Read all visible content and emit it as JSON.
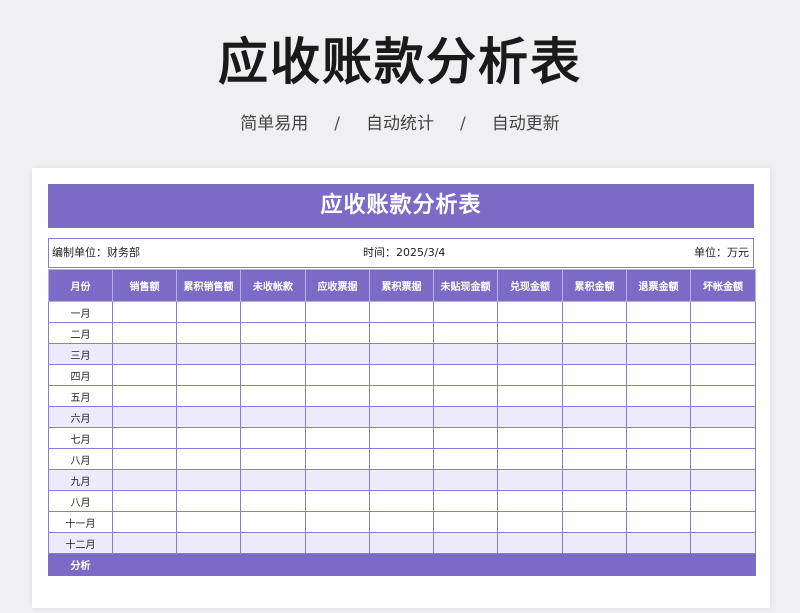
{
  "header": {
    "title": "应收账款分析表",
    "tags": [
      "简单易用",
      "自动统计",
      "自动更新"
    ],
    "separator": "/"
  },
  "sheet": {
    "banner": "应收账款分析表",
    "info": {
      "unit_label": "编制单位：财务部",
      "time_label": "时间：2025/3/4",
      "currency_label": "单位：万元"
    },
    "columns": [
      "月份",
      "销售额",
      "累积销售额",
      "未收帐款",
      "应收票据",
      "累积票据",
      "未贴现金额",
      "兑现金额",
      "累积金额",
      "退票金额",
      "坏帐金额"
    ],
    "months": [
      "一月",
      "二月",
      "三月",
      "四月",
      "五月",
      "六月",
      "七月",
      "八月",
      "九月",
      "八月",
      "十一月",
      "十二月"
    ],
    "summary_label": "分析"
  },
  "colors": {
    "accent": "#7b6ac6",
    "row_alt": "#eceafb",
    "background": "#f0f0f2"
  }
}
